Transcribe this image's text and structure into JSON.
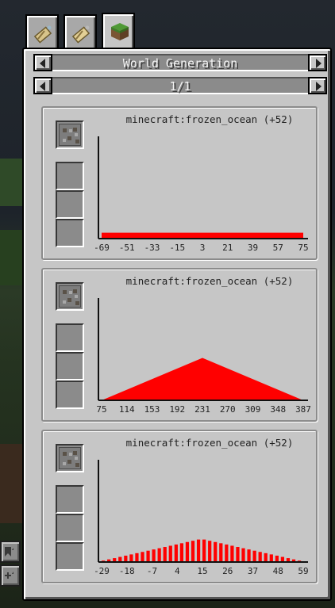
{
  "tabs": [
    {
      "name": "tab-item-a",
      "icon": "map-scroll-icon",
      "active": false
    },
    {
      "name": "tab-item-b",
      "icon": "map-scroll-icon",
      "active": false
    },
    {
      "name": "tab-world-generation",
      "icon": "grass-block-icon",
      "active": true
    }
  ],
  "header": {
    "title": "World Generation",
    "page": "1/1"
  },
  "cards": [
    {
      "title": "minecraft:frozen_ocean (+52)",
      "item_icon": "gravel-ore-icon",
      "empty_slots": 3
    },
    {
      "title": "minecraft:frozen_ocean (+52)",
      "item_icon": "gravel-ore-icon",
      "empty_slots": 3
    },
    {
      "title": "minecraft:frozen_ocean (+52)",
      "item_icon": "gravel-ore-icon",
      "empty_slots": 3
    }
  ],
  "chart_data": [
    {
      "type": "bar",
      "x_ticks": [
        "-69",
        "-51",
        "-33",
        "-15",
        "3",
        "21",
        "39",
        "57",
        "75"
      ],
      "xlim": [
        -69,
        75
      ],
      "ylim": [
        0,
        1
      ],
      "shape": "uniform",
      "values": [
        {
          "from": -69,
          "to": 75,
          "value": 0.05
        }
      ],
      "color": "#ff0000"
    },
    {
      "type": "area",
      "x_ticks": [
        "75",
        "114",
        "153",
        "192",
        "231",
        "270",
        "309",
        "348",
        "387"
      ],
      "xlim": [
        75,
        387
      ],
      "ylim": [
        0,
        1
      ],
      "shape": "triangular",
      "points": [
        [
          78,
          0
        ],
        [
          231,
          0.41
        ],
        [
          384,
          0
        ]
      ],
      "color": "#ff0000"
    },
    {
      "type": "bar",
      "x_ticks": [
        "-29",
        "-18",
        "-7",
        "4",
        "15",
        "26",
        "37",
        "48",
        "59"
      ],
      "xlim": [
        -29,
        59
      ],
      "ylim": [
        0,
        1
      ],
      "shape": "triangular-striped",
      "points": [
        [
          -29,
          0
        ],
        [
          15,
          0.22
        ],
        [
          59,
          0
        ]
      ],
      "color": "#ff0000"
    }
  ],
  "sidebar": {
    "buttons": [
      {
        "icon": "bookmark-icon"
      },
      {
        "icon": "add-bookmark-icon"
      }
    ]
  }
}
